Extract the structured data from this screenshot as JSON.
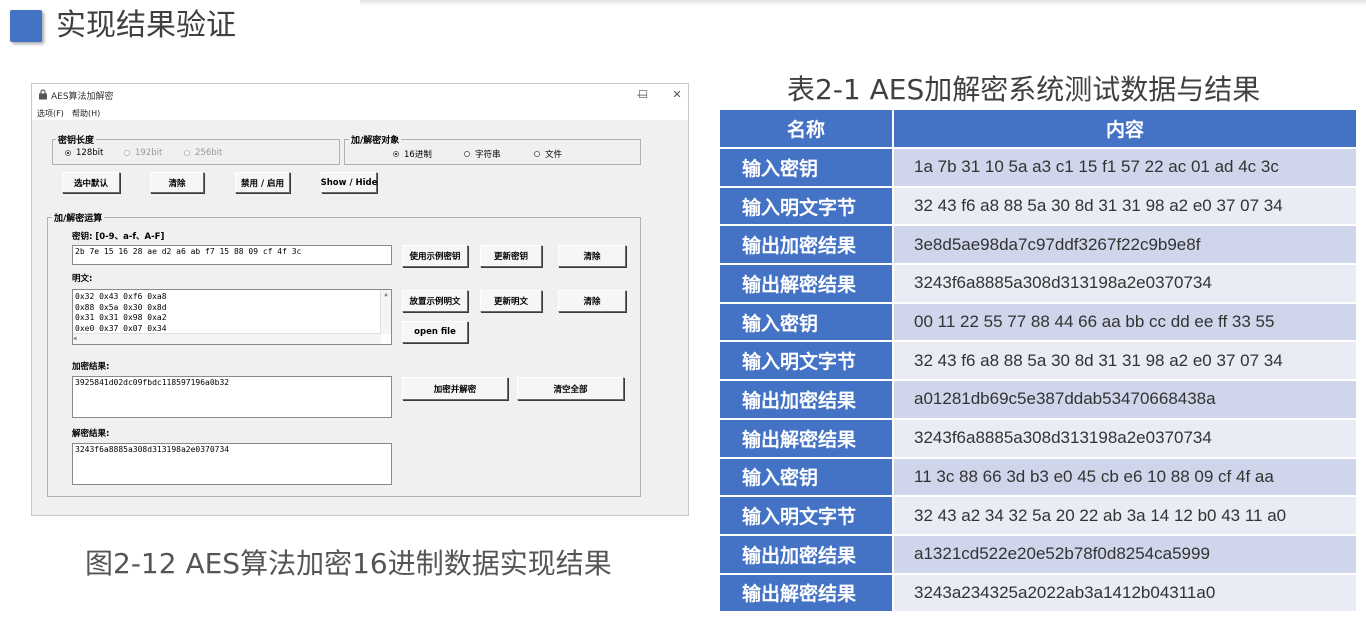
{
  "slide": {
    "title": "实现结果验证",
    "accent_color": "#4472c4"
  },
  "window": {
    "title": "AES算法加解密",
    "controls": {
      "minimize": "—",
      "maximize": "☐",
      "close": "✕"
    },
    "menu": [
      "选项(F)",
      "帮助(H)"
    ],
    "key_length": {
      "label": "密钥长度",
      "options": [
        "128bit",
        "192bit",
        "256bit"
      ],
      "selected": "128bit"
    },
    "target": {
      "label": "加/解密对象",
      "options": [
        "16进制",
        "字符串",
        "文件"
      ],
      "selected": "16进制"
    },
    "toolbar": {
      "select_default": "选中默认",
      "clear": "清除",
      "disable_enable": "禁用 / 启用",
      "show_hide": "Show / Hide"
    },
    "ops": {
      "label": "加/解密运算",
      "key_label": "密钥: [0-9、a-f、A-F]",
      "key_value": "2b 7e 15 16 28 ae d2 a6 ab f7 15 88 09 cf 4f 3c",
      "use_example_key": "使用示例密钥",
      "update_key": "更新密钥",
      "clear_key": "清除",
      "plaintext_label": "明文:",
      "plaintext_lines": [
        "0x32 0x43 0xf6 0xa8",
        "0x88 0x5a 0x30 0x8d",
        "0x31 0x31 0x98 0xa2",
        "0xe0 0x37 0x07 0x34"
      ],
      "place_example_plaintext": "放置示例明文",
      "update_plaintext": "更新明文",
      "clear_plaintext": "清除",
      "open_file": "open file",
      "encrypt_label": "加密结果:",
      "encrypt_value": "3925841d02dc09fbdc118597196a0b32",
      "encrypt_decrypt": "加密并解密",
      "clear_all": "清空全部",
      "decrypt_label": "解密结果:",
      "decrypt_value": "3243f6a8885a308d313198a2e0370734"
    },
    "caption": "图2-12 AES算法加密16进制数据实现结果"
  },
  "table": {
    "caption": "表2-1 AES加解密系统测试数据与结果",
    "headers": [
      "名称",
      "内容"
    ],
    "rows": [
      {
        "name": "输入密钥",
        "value": "1a 7b 31 10 5a a3 c1 15 f1 57 22 ac 01 ad 4c 3c"
      },
      {
        "name": "输入明文字节",
        "value": "32 43 f6 a8 88 5a 30 8d 31 31 98 a2 e0 37 07 34"
      },
      {
        "name": "输出加密结果",
        "value": "3e8d5ae98da7c97ddf3267f22c9b9e8f"
      },
      {
        "name": "输出解密结果",
        "value": "3243f6a8885a308d313198a2e0370734"
      },
      {
        "name": "输入密钥",
        "value": "00 11 22 55 77 88 44 66 aa bb cc dd ee ff 33 55"
      },
      {
        "name": "输入明文字节",
        "value": "32 43 f6 a8 88 5a 30 8d 31 31 98 a2 e0 37 07 34"
      },
      {
        "name": "输出加密结果",
        "value": "a01281db69c5e387ddab53470668438a"
      },
      {
        "name": "输出解密结果",
        "value": "3243f6a8885a308d313198a2e0370734"
      },
      {
        "name": "输入密钥",
        "value": "11 3c 88 66 3d b3 e0 45 cb e6 10 88 09 cf 4f aa"
      },
      {
        "name": "输入明文字节",
        "value": "32 43 a2 34 32 5a 20 22 ab 3a 14 12 b0 43 11 a0"
      },
      {
        "name": "输出加密结果",
        "value": "a1321cd522e20e52b78f0d8254ca5999"
      },
      {
        "name": "输出解密结果",
        "value": "3243a234325a2022ab3a1412b04311a0"
      }
    ]
  }
}
